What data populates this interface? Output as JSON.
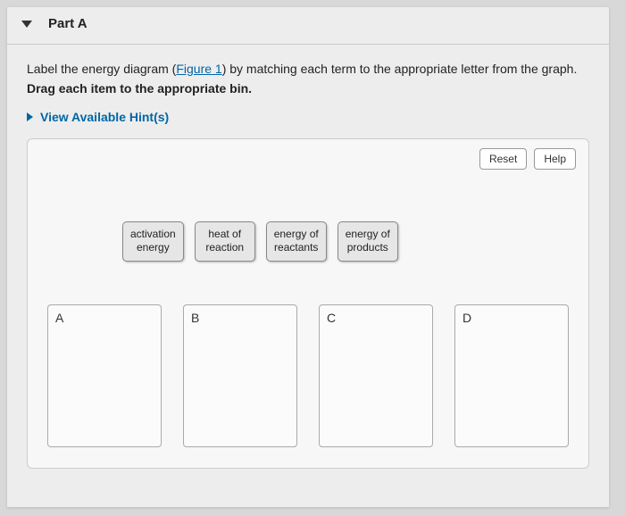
{
  "part": {
    "title": "Part A"
  },
  "instructions": {
    "line1_pre": "Label the energy diagram (",
    "figure_text": "Figure 1",
    "line1_post": ") by matching each term to the appropriate letter from the graph.",
    "line2": "Drag each item to the appropriate bin."
  },
  "hints": {
    "label": "View Available Hint(s)"
  },
  "buttons": {
    "reset": "Reset",
    "help": "Help"
  },
  "dragItems": [
    "activation\nenergy",
    "heat of\nreaction",
    "energy of\nreactants",
    "energy of\nproducts"
  ],
  "bins": [
    {
      "label": "A"
    },
    {
      "label": "B"
    },
    {
      "label": "C"
    },
    {
      "label": "D"
    }
  ]
}
